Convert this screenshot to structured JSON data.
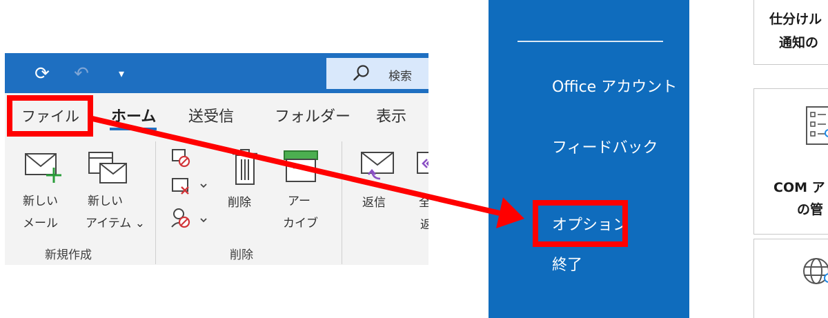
{
  "outlook_ribbon": {
    "search_label": "検索",
    "tabs": [
      "ファイル",
      "ホーム",
      "送受信",
      "フォルダー",
      "表示"
    ],
    "buttons": {
      "new_mail": [
        "新しい",
        "メール"
      ],
      "new_item": [
        "新しい",
        "アイテム ⌄"
      ],
      "delete": "削除",
      "archive": [
        "アー",
        "カイブ"
      ],
      "reply": "返信",
      "reply_all_partial": [
        "全",
        "返"
      ]
    },
    "groups": {
      "new": "新規作成",
      "delete": "削除"
    }
  },
  "backstage": {
    "nav": {
      "account": "Office アカウント",
      "feedback": "フィードバック",
      "options": "オプション",
      "exit": "終了"
    },
    "cards": {
      "rules_line1": "仕分けル",
      "rules_line2": "通知の",
      "com_line1": "COM ア",
      "com_line2": "の管"
    }
  },
  "colors": {
    "titlebar": "#1e6fc1",
    "backstage_nav": "#0f6cbd",
    "highlight": "#ff0000",
    "ribbon_bg": "#f3f3f3"
  },
  "icons": [
    "sync-icon",
    "undo-icon",
    "qat-dropdown-icon",
    "search-icon",
    "new-mail-icon",
    "new-item-icon",
    "ignore-icon",
    "cleanup-icon",
    "junk-icon",
    "delete-icon",
    "archive-icon",
    "reply-icon",
    "reply-all-icon",
    "rules-icon",
    "addins-icon",
    "globe-icon"
  ]
}
